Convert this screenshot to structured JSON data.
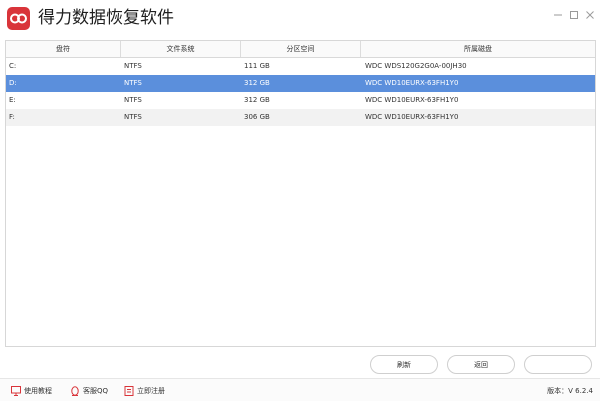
{
  "window": {
    "title": "得力数据恢复软件",
    "brand_color": "#d9343a",
    "controls": [
      "minimize-icon",
      "maximize-icon",
      "close-icon"
    ]
  },
  "table": {
    "columns": [
      "盘符",
      "文件系统",
      "分区空间",
      "所属磁盘"
    ],
    "rows": [
      {
        "drive": "C:",
        "fs": "NTFS",
        "size": "111 GB",
        "disk": "WDC WDS120G2G0A-00JH30",
        "selected": false
      },
      {
        "drive": "D:",
        "fs": "NTFS",
        "size": "312 GB",
        "disk": "WDC WD10EURX-63FH1Y0",
        "selected": true
      },
      {
        "drive": "E:",
        "fs": "NTFS",
        "size": "312 GB",
        "disk": "WDC WD10EURX-63FH1Y0",
        "selected": false
      },
      {
        "drive": "F:",
        "fs": "NTFS",
        "size": "306 GB",
        "disk": "WDC WD10EURX-63FH1Y0",
        "selected": false
      }
    ],
    "selected_color": "#5b8fdc"
  },
  "buttons": {
    "refresh": "刷新",
    "back": "返回",
    "third": ""
  },
  "footer": {
    "tutorial": "使用教程",
    "support": "客服QQ",
    "register": "立即注册",
    "version": "版本：V 6.2.4"
  }
}
